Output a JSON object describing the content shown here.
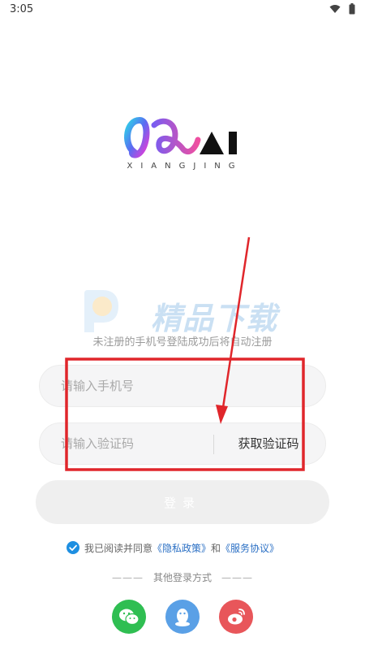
{
  "status_bar": {
    "time": "3:05"
  },
  "logo": {
    "mark": "AI",
    "subtitle": "XIANGJING"
  },
  "watermark": {
    "text": "精品下载"
  },
  "hint": "未注册的手机号登陆成功后将自动注册",
  "phone": {
    "placeholder": "请输入手机号",
    "value": ""
  },
  "code": {
    "placeholder": "请输入验证码",
    "value": "",
    "get_code_label": "获取验证码"
  },
  "login": {
    "label": "登录"
  },
  "agreement": {
    "prefix": "我已阅读并同意",
    "privacy": "《隐私政策》",
    "and": "和",
    "service": "《服务协议》",
    "checked": true
  },
  "other_login": {
    "dash_left": "———",
    "label": "其他登录方式",
    "dash_right": "———"
  },
  "social_icons": [
    "wechat-icon",
    "qq-icon",
    "weibo-icon"
  ],
  "colors": {
    "annotation_red": "#e0262b",
    "link_blue": "#2a6fc4",
    "check_blue": "#1e8fe1"
  }
}
